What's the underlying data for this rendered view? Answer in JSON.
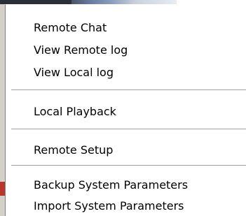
{
  "menu": {
    "items": [
      {
        "label": "Remote Chat"
      },
      {
        "label": "View Remote log"
      },
      {
        "label": "View Local log"
      },
      {
        "label": "Local Playback"
      },
      {
        "label": "Remote Setup"
      },
      {
        "label": "Backup System Parameters"
      },
      {
        "label": "Import System Parameters"
      }
    ]
  }
}
